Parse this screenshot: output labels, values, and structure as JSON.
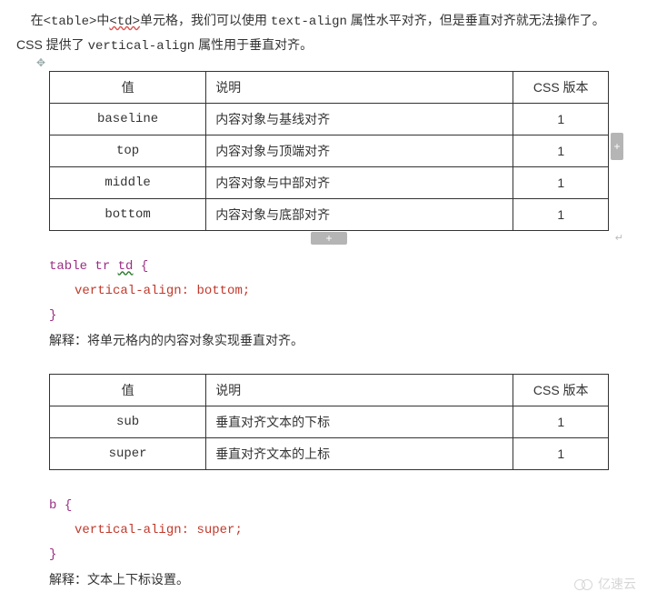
{
  "intro": {
    "part1": "在",
    "tag1": "<table>",
    "part2": "中",
    "tag2": "<td>",
    "part3": "单元格，我们可以使用 ",
    "prop1": "text-align",
    "part4": " 属性水平对齐，但是垂直对齐就无法操作了。CSS 提供了 ",
    "prop2": "vertical-align",
    "part5": " 属性用于垂直对齐。"
  },
  "table1": {
    "headers": {
      "val": "值",
      "desc": "说明",
      "ver": "CSS 版本"
    },
    "rows": [
      {
        "val": "baseline",
        "desc": "内容对象与基线对齐",
        "ver": "1"
      },
      {
        "val": "top",
        "desc": "内容对象与顶端对齐",
        "ver": "1"
      },
      {
        "val": "middle",
        "desc": "内容对象与中部对齐",
        "ver": "1"
      },
      {
        "val": "bottom",
        "desc": "内容对象与底部对齐",
        "ver": "1"
      }
    ]
  },
  "code1": {
    "selector": {
      "s1": "table",
      "s2": "tr",
      "s3": "td"
    },
    "brace_open": "{",
    "prop": "vertical-align",
    "colon": ": ",
    "value": "bottom",
    "semi": ";",
    "brace_close": "}"
  },
  "explain1": "解释：将单元格内的内容对象实现垂直对齐。",
  "table2": {
    "headers": {
      "val": "值",
      "desc": "说明",
      "ver": "CSS 版本"
    },
    "rows": [
      {
        "val": "sub",
        "desc": "垂直对齐文本的下标",
        "ver": "1"
      },
      {
        "val": "super",
        "desc": "垂直对齐文本的上标",
        "ver": "1"
      }
    ]
  },
  "code2": {
    "selector": "b",
    "brace_open": "{",
    "prop": "vertical-align",
    "colon": ": ",
    "value": "super",
    "semi": ";",
    "brace_close": "}"
  },
  "explain2": "解释：文本上下标设置。",
  "watermark": "亿速云",
  "handles": {
    "move": "✥",
    "plus_col": "+",
    "plus_row": "+",
    "para": "↵"
  },
  "chart_data": [
    {
      "type": "table",
      "title": "vertical-align values (block)",
      "columns": [
        "值",
        "说明",
        "CSS 版本"
      ],
      "rows": [
        [
          "baseline",
          "内容对象与基线对齐",
          1
        ],
        [
          "top",
          "内容对象与顶端对齐",
          1
        ],
        [
          "middle",
          "内容对象与中部对齐",
          1
        ],
        [
          "bottom",
          "内容对象与底部对齐",
          1
        ]
      ]
    },
    {
      "type": "table",
      "title": "vertical-align values (text sub/super)",
      "columns": [
        "值",
        "说明",
        "CSS 版本"
      ],
      "rows": [
        [
          "sub",
          "垂直对齐文本的下标",
          1
        ],
        [
          "super",
          "垂直对齐文本的上标",
          1
        ]
      ]
    }
  ]
}
